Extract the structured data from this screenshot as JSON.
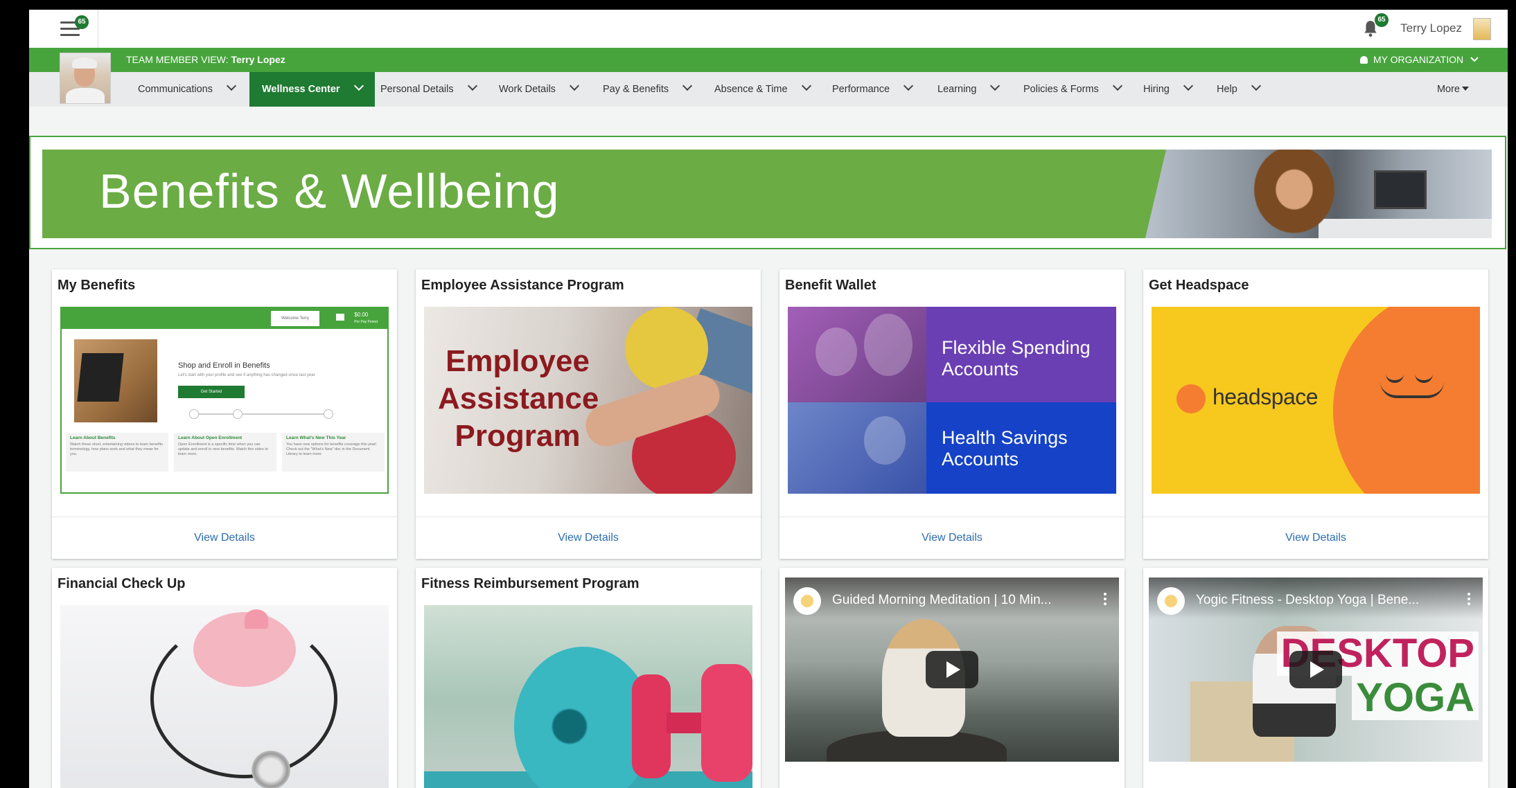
{
  "topbar": {
    "menu_badge": "65",
    "notif_badge": "65",
    "user_name": "Terry Lopez"
  },
  "greenbar": {
    "view_label": "TEAM MEMBER VIEW:",
    "view_name": "Terry Lopez",
    "my_org": "MY ORGANIZATION"
  },
  "nav": {
    "items": [
      {
        "label": "Communications"
      },
      {
        "label": "Wellness Center",
        "active": true
      },
      {
        "label": "Personal Details"
      },
      {
        "label": "Work Details"
      },
      {
        "label": "Pay & Benefits"
      },
      {
        "label": "Absence & Time"
      },
      {
        "label": "Performance"
      },
      {
        "label": "Learning"
      },
      {
        "label": "Policies & Forms"
      },
      {
        "label": "Hiring"
      },
      {
        "label": "Help"
      }
    ],
    "more": "More"
  },
  "banner": {
    "title": "Benefits & Wellbeing"
  },
  "cards": [
    {
      "title": "My Benefits",
      "action": "View Details",
      "mock": {
        "welcome": "Welcome Terry",
        "amount": "$0.00",
        "amount_sub": "Per Pay Period",
        "heading": "Shop and Enroll in Benefits",
        "subtext": "Let's start with your profile and see if anything has changed since last year.",
        "button": "Get Started",
        "col1_title": "Learn About Benefits",
        "col1_text": "Watch these short, entertaining videos to learn benefits terminology, how plans work and what they mean for you.",
        "col2_title": "Learn About Open Enrollment",
        "col2_text": "Open Enrollment is a specific time when you can update and enroll in new benefits. Watch this video to learn more.",
        "col3_title": "Learn What's New This Year",
        "col3_text": "You have new options for benefits coverage this year! Check out the \"What's New\" doc in the Document Library to learn more."
      }
    },
    {
      "title": "Employee Assistance Program",
      "action": "View Details",
      "image_text": "Employee Assistance Program"
    },
    {
      "title": "Benefit Wallet",
      "action": "View Details",
      "fsa": "Flexible Spending Accounts",
      "hsa": "Health Savings Accounts"
    },
    {
      "title": "Get Headspace",
      "action": "View Details",
      "logo": "headspace"
    },
    {
      "title": "Financial Check Up"
    },
    {
      "title": "Fitness Reimbursement Program"
    }
  ],
  "videos": [
    {
      "title": "Guided Morning Meditation | 10 Min..."
    },
    {
      "title": "Yogic Fitness - Desktop Yoga | Bene...",
      "overlay_line1": "DESKTOP",
      "overlay_line2": "YOGA"
    }
  ],
  "colors": {
    "brand_green": "#47a43c",
    "active_green": "#1f7a32",
    "link_blue": "#2b6cb0"
  }
}
